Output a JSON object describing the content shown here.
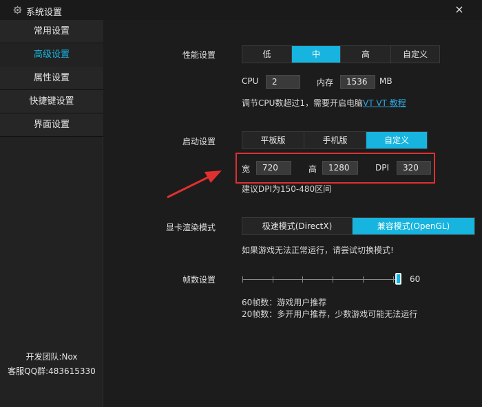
{
  "window": {
    "title": "系统设置",
    "close_glyph": "×",
    "icon": "gear-icon"
  },
  "sidebar": {
    "items": [
      {
        "label": "常用设置"
      },
      {
        "label": "高级设置",
        "active": true
      },
      {
        "label": "属性设置"
      },
      {
        "label": "快捷键设置"
      },
      {
        "label": "界面设置"
      }
    ],
    "footer_team": "开发团队:Nox",
    "footer_qq": "客服QQ群:483615330"
  },
  "performance": {
    "label": "性能设置",
    "options": [
      "低",
      "中",
      "高",
      "自定义"
    ],
    "selected": "中",
    "cpu_label": "CPU",
    "cpu_value": "2",
    "mem_label": "内存",
    "mem_value": "1536",
    "mem_unit": "MB",
    "hint_text": "调节CPU数超过1，需要开启电脑",
    "hint_link": "VT VT 教程"
  },
  "startup": {
    "label": "启动设置",
    "options": [
      "平板版",
      "手机版",
      "自定义"
    ],
    "selected": "自定义",
    "width_label": "宽",
    "width_value": "720",
    "height_label": "高",
    "height_value": "1280",
    "dpi_label": "DPI",
    "dpi_value": "320",
    "dpi_hint": "建议DPI为150-480区间"
  },
  "render": {
    "label": "显卡渲染模式",
    "options": [
      "极速模式(DirectX)",
      "兼容模式(OpenGL)"
    ],
    "selected": "兼容模式(OpenGL)",
    "hint": "如果游戏无法正常运行，请尝试切换模式!"
  },
  "fps": {
    "label": "帧数设置",
    "value": "60",
    "level": 1.0,
    "hint1": "60帧数：游戏用户推荐",
    "hint2": "20帧数：多开用户推荐，少数游戏可能无法运行"
  },
  "colors": {
    "accent": "#16b4de",
    "highlight_box": "#e0302f",
    "link": "#2ea7e0"
  }
}
